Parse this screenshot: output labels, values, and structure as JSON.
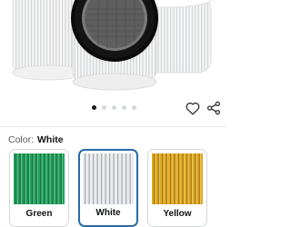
{
  "product": {
    "image_alt": "Air purifier replacement filters, white",
    "gallery": {
      "image_count": 5,
      "active_index": 0
    }
  },
  "actions": {
    "wishlist_icon": "heart-icon",
    "share_icon": "share-icon"
  },
  "variation": {
    "label": "Color:",
    "selected_value": "White",
    "options": [
      {
        "label": "Green",
        "color": "#1fa05a"
      },
      {
        "label": "White",
        "color": "#e9eaec",
        "selected": true
      },
      {
        "label": "Yellow",
        "color": "#e3a91c"
      }
    ]
  },
  "colors": {
    "selected_border": "#2a6aa6",
    "dot_active": "#1a1a1a",
    "dot_inactive": "#d5d9d9"
  }
}
